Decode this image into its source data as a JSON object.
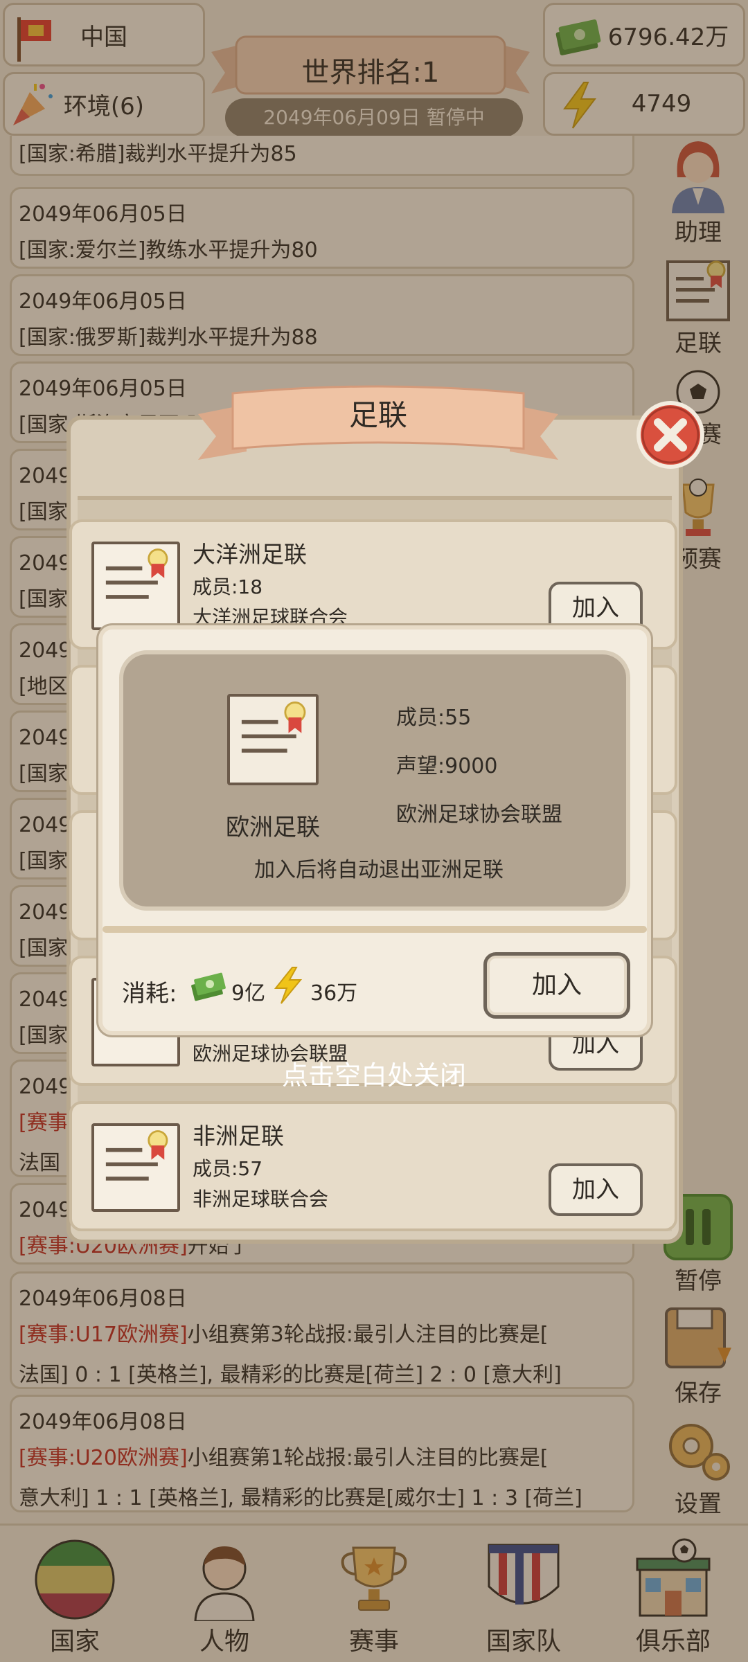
{
  "top": {
    "country": "中国",
    "environment": "环境(6)",
    "rank_title": "世界排名:1",
    "date_status": "2049年06月09日 暂停中",
    "money": "6796.42万",
    "energy": "4749"
  },
  "logs": [
    {
      "l1": "[国家:希腊]裁判水平提升为85"
    },
    {
      "l1": "2049年06月05日",
      "l2": "[国家:爱尔兰]教练水平提升为80"
    },
    {
      "l1": "2049年06月05日",
      "l2": "[国家:俄罗斯]裁判水平提升为88"
    },
    {
      "l1": "2049年06月05日",
      "l2": "[国家:斯洛文尼亚]球"
    },
    {
      "l1": "2049",
      "l2": "[国家"
    },
    {
      "l1": "2049",
      "l2": "[国家"
    },
    {
      "l1": "2049",
      "l2": "[地区"
    },
    {
      "l1": "2049",
      "l2": "[国家"
    },
    {
      "l1": "2049",
      "l2": "[国家"
    },
    {
      "l1": "2049",
      "l2": "[国家"
    },
    {
      "l1": "2049",
      "l2": "[国家"
    },
    {
      "l1": "2049",
      "l2_red": "[赛事",
      "l3": "法国"
    },
    {
      "l1": "2049",
      "l2_red": "[赛事:U20欧洲赛]",
      "l2": "开始了"
    },
    {
      "l1": "2049年06月08日",
      "l2_red": "[赛事:U17欧洲赛]",
      "l2": "小组赛第3轮战报:最引人注目的比赛是[",
      "l3": "法国] 0 : 1 [英格兰], 最精彩的比赛是[荷兰] 2 : 0 [意大利]"
    },
    {
      "l1": "2049年06月08日",
      "l2_red": "[赛事:U20欧洲赛]",
      "l2": "小组赛第1轮战报:最引人注目的比赛是[",
      "l3": "意大利] 1 : 1 [英格兰], 最精彩的比赛是[威尔士] 1 : 3 [荷兰]"
    }
  ],
  "side": {
    "assistant": "助理",
    "federation": "足联",
    "league": "组赛",
    "qualifier": "预赛",
    "pause": "暂停",
    "save": "保存",
    "settings": "设置"
  },
  "nav": {
    "country": "国家",
    "people": "人物",
    "events": "赛事",
    "national_team": "国家队",
    "club": "俱乐部"
  },
  "panel": {
    "title": "足联",
    "cards": [
      {
        "name": "大洋洲足联",
        "members": "成员:18",
        "desc": "大洋洲足球联合会",
        "join": "加入"
      },
      {
        "name": "",
        "members": "",
        "desc": "",
        "join": ""
      },
      {
        "name": "",
        "members": "",
        "desc": "",
        "join": ""
      },
      {
        "name": "",
        "members": "",
        "desc": "欧洲足球协会联盟",
        "join": "加入"
      },
      {
        "name": "非洲足联",
        "members": "成员:57",
        "desc": "非洲足球联合会",
        "join": "加入"
      }
    ]
  },
  "popup": {
    "name": "欧洲足联",
    "members": "成员:55",
    "prestige": "声望:9000",
    "full_name": "欧洲足球协会联盟",
    "note": "加入后将自动退出亚洲足联",
    "cost_label": "消耗:",
    "cost_money": "9亿",
    "cost_energy": "36万",
    "join": "加入"
  },
  "hint": "点击空白处关闭",
  "colors": {
    "accent_red": "#c02a20",
    "money_green": "#5a9a3a",
    "energy_yellow": "#f0c419"
  }
}
